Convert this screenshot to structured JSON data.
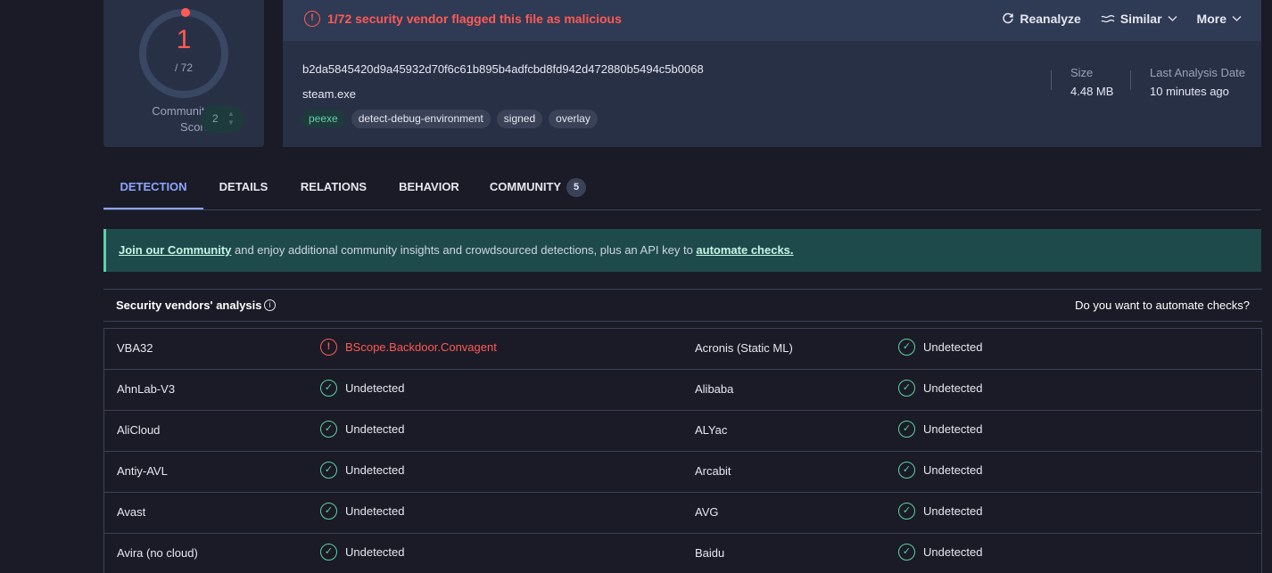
{
  "score": {
    "detections": "1",
    "total": "/ 72",
    "community_label_line1": "Community",
    "community_label_line2": "Score",
    "community_value": "2"
  },
  "alert": {
    "text": "1/72 security vendor flagged this file as malicious",
    "reanalyze": "Reanalyze",
    "similar": "Similar",
    "more": "More"
  },
  "file": {
    "hash": "b2da5845420d9a45932d70f6c61b895b4adfcbd8fd942d472880b5494c5b0068",
    "name": "steam.exe",
    "tags": [
      "peexe",
      "detect-debug-environment",
      "signed",
      "overlay"
    ],
    "size_label": "Size",
    "size_value": "4.48 MB",
    "last_analysis_label": "Last Analysis Date",
    "last_analysis_value": "10 minutes ago"
  },
  "tabs": [
    {
      "label": "DETECTION"
    },
    {
      "label": "DETAILS"
    },
    {
      "label": "RELATIONS"
    },
    {
      "label": "BEHAVIOR"
    },
    {
      "label": "COMMUNITY",
      "count": "5"
    }
  ],
  "banner": {
    "link1": "Join our Community",
    "middle": " and enjoy additional community insights and crowdsourced detections, plus an API key to ",
    "link2": "automate checks."
  },
  "vendors": {
    "title": "Security vendors' analysis",
    "automate_question": "Do you want to automate checks?",
    "rows": [
      {
        "left_vendor": "VBA32",
        "left_result": "BScope.Backdoor.Convagent",
        "right_vendor": "Acronis (Static ML)",
        "right_result": "Undetected"
      },
      {
        "left_vendor": "AhnLab-V3",
        "left_result": "Undetected",
        "right_vendor": "Alibaba",
        "right_result": "Undetected"
      },
      {
        "left_vendor": "AliCloud",
        "left_result": "Undetected",
        "right_vendor": "ALYac",
        "right_result": "Undetected"
      },
      {
        "left_vendor": "Antiy-AVL",
        "left_result": "Undetected",
        "right_vendor": "Arcabit",
        "right_result": "Undetected"
      },
      {
        "left_vendor": "Avast",
        "left_result": "Undetected",
        "right_vendor": "AVG",
        "right_result": "Undetected"
      },
      {
        "left_vendor": "Avira (no cloud)",
        "left_result": "Undetected",
        "right_vendor": "Baidu",
        "right_result": "Undetected"
      }
    ]
  },
  "colors": {
    "malicious": "#ff5a55",
    "clean": "#5fd1a6",
    "accent": "#8ea4ff"
  }
}
